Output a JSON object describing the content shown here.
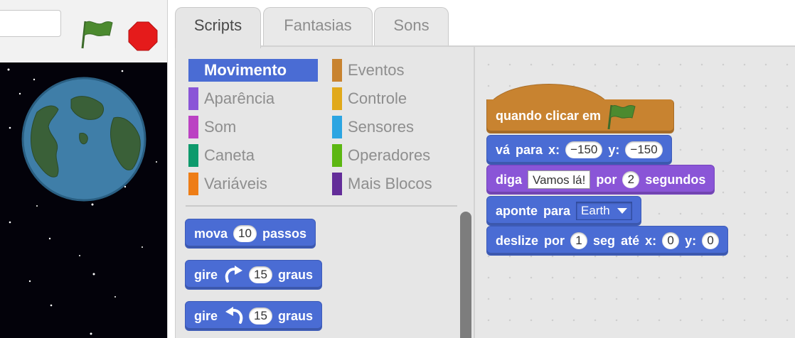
{
  "stage_header": {
    "project_title": ""
  },
  "tabs": [
    {
      "label": "Scripts"
    },
    {
      "label": "Fantasias"
    },
    {
      "label": "Sons"
    }
  ],
  "categories": [
    {
      "label": "Movimento",
      "color": "#4a6cd4"
    },
    {
      "label": "Aparência",
      "color": "#8a55d7"
    },
    {
      "label": "Som",
      "color": "#bb42c3"
    },
    {
      "label": "Caneta",
      "color": "#0e9a6c"
    },
    {
      "label": "Variáveis",
      "color": "#ee7d16"
    },
    {
      "label": "Eventos",
      "color": "#c88330"
    },
    {
      "label": "Controle",
      "color": "#e1a91a"
    },
    {
      "label": "Sensores",
      "color": "#2ca5e2"
    },
    {
      "label": "Operadores",
      "color": "#5cb712"
    },
    {
      "label": "Mais Blocos",
      "color": "#632d99"
    }
  ],
  "palette_blocks": {
    "move": {
      "w1": "mova",
      "steps": "10",
      "w2": "passos"
    },
    "turn_right": {
      "w1": "gire",
      "degrees": "15",
      "w2": "graus"
    },
    "turn_left": {
      "w1": "gire",
      "degrees": "15",
      "w2": "graus"
    }
  },
  "script": {
    "hat": {
      "label": "quando clicar em"
    },
    "goto": {
      "w1": "vá",
      "w2": "para",
      "w3": "x:",
      "x": "−150",
      "w4": "y:",
      "y": "−150"
    },
    "say": {
      "w1": "diga",
      "text": "Vamos lá!",
      "w2": "por",
      "secs": "2",
      "w3": "segundos"
    },
    "point": {
      "w1": "aponte",
      "w2": "para",
      "target": "Earth"
    },
    "glide": {
      "w1": "deslize",
      "w2": "por",
      "secs": "1",
      "w3": "seg",
      "w4": "até",
      "w5": "x:",
      "x": "0",
      "w6": "y:",
      "y": "0"
    }
  }
}
